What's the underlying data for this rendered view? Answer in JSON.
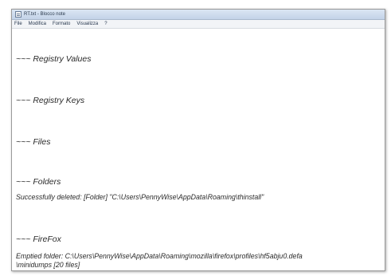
{
  "window": {
    "title": "RT.txt - Blocco note"
  },
  "menu": {
    "items": [
      "File",
      "Modifica",
      "Formato",
      "Visualizza",
      "?"
    ]
  },
  "content": {
    "registry_values": "~~~ Registry Values",
    "registry_keys": "~~~ Registry Keys",
    "files": "~~~ Files",
    "folders": "~~~ Folders",
    "folders_result": "Successfully deleted: [Folder] \"C:\\Users\\PennyWise\\AppData\\Roaming\\thinstall\"",
    "firefox": "~~~ FireFox",
    "firefox_result_1": "Emptied folder: C:\\Users\\PennyWise\\AppData\\Roaming\\mozilla\\firefox\\profiles\\hf5abju0.defa",
    "firefox_result_2": "\\minidumps [20 files]"
  }
}
